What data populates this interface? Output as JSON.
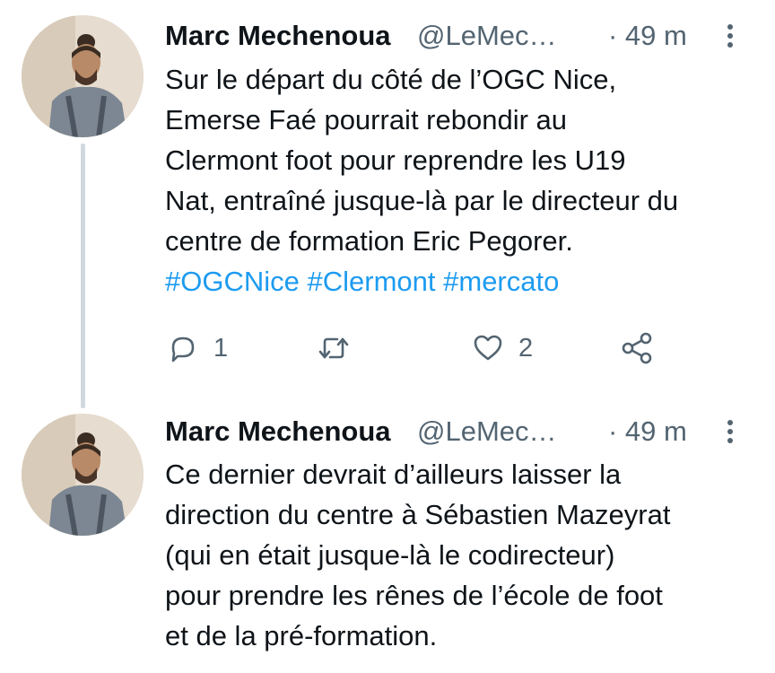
{
  "tweets": [
    {
      "author": {
        "name": "Marc Mechenoua",
        "handle": "@LeMec…"
      },
      "timestamp": "· 49 m",
      "lines": [
        "Sur le départ du côté de l’OGC Nice,",
        "Emerse Faé pourrait rebondir au",
        "Clermont foot pour reprendre les U19",
        "Nat, entraîné jusque-là par le directeur du",
        "centre de formation Eric Pegorer."
      ],
      "hashtags": [
        "#OGCNice",
        "#Clermont",
        "#mercato"
      ],
      "actions": {
        "replies": "1",
        "retweets": "",
        "likes": "2"
      }
    },
    {
      "author": {
        "name": "Marc Mechenoua",
        "handle": "@LeMec…"
      },
      "timestamp": "· 49 m",
      "lines": [
        "Ce dernier devrait d’ailleurs laisser la",
        "direction du centre à Sébastien Mazeyrat",
        "(qui en était jusque-là le codirecteur)",
        "pour prendre les rênes de l’école de foot",
        "et de la pré-formation."
      ]
    }
  ],
  "colors": {
    "text": "#0f1419",
    "secondary": "#536471",
    "link": "#1d9bf0",
    "thread_line": "#cfd9de"
  },
  "icons": {
    "more": "more-vertical-icon",
    "reply": "reply-icon",
    "retweet": "retweet-icon",
    "like": "heart-icon",
    "share": "share-icon"
  }
}
